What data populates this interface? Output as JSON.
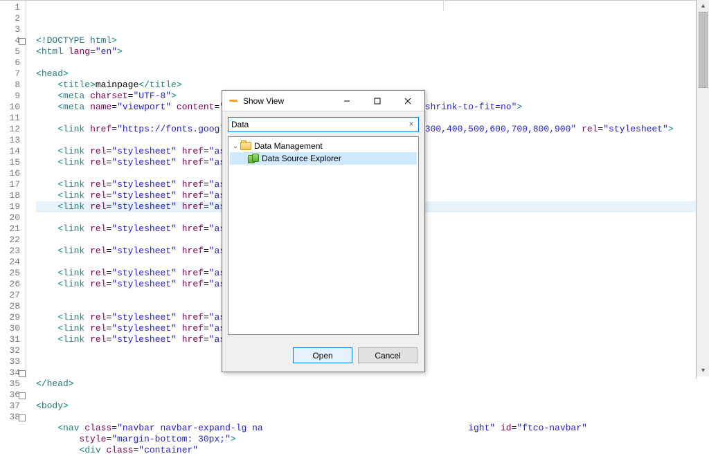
{
  "editor": {
    "lines": [
      {
        "n": "1",
        "fold": "",
        "html": "<span class='punc'>&lt;!</span><span class='tag'>DOCTYPE</span> <span class='kw'>html</span><span class='punc'>&gt;</span>"
      },
      {
        "n": "2",
        "fold": "",
        "html": "<span class='punc'>&lt;</span><span class='tag'>html</span> <span class='attr'>lang</span>=<span class='val'>\"en\"</span><span class='punc'>&gt;</span>"
      },
      {
        "n": "3",
        "fold": "",
        "html": ""
      },
      {
        "n": "4",
        "fold": "minus",
        "html": "<span class='punc'>&lt;</span><span class='tag'>head</span><span class='punc'>&gt;</span>"
      },
      {
        "n": "5",
        "fold": "",
        "html": "    <span class='punc'>&lt;</span><span class='tag'>title</span><span class='punc'>&gt;</span>mainpage<span class='punc'>&lt;/</span><span class='tag'>title</span><span class='punc'>&gt;</span>"
      },
      {
        "n": "6",
        "fold": "",
        "html": "    <span class='punc'>&lt;</span><span class='tag'>meta</span> <span class='attr'>charset</span>=<span class='val'>\"UTF-8\"</span><span class='punc'>&gt;</span>"
      },
      {
        "n": "7",
        "fold": "",
        "html": "    <span class='punc'>&lt;</span><span class='tag'>meta</span> <span class='attr'>name</span>=<span class='val'>\"viewport\"</span> <span class='attr'>content</span>=<span class='val'>\"width=device-width, initial-scale=1, shrink-to-fit=no\"</span><span class='punc'>&gt;</span>"
      },
      {
        "n": "8",
        "fold": "",
        "html": ""
      },
      {
        "n": "9",
        "fold": "",
        "html": "    <span class='punc'>&lt;</span><span class='tag'>link</span> <span class='attr'>href</span>=<span class='val'>\"https://fonts.googleapis.com/css?family=Poppins:100,200,300,400,500,600,700,800,900\"</span> <span class='attr'>rel</span>=<span class='val'>\"stylesheet\"</span><span class='punc'>&gt;</span>"
      },
      {
        "n": "10",
        "fold": "",
        "html": ""
      },
      {
        "n": "11",
        "fold": "",
        "html": "    <span class='punc'>&lt;</span><span class='tag'>link</span> <span class='attr'>rel</span>=<span class='val'>\"stylesheet\"</span> <span class='attr'>href</span>=<span class='val'>\"assets/cs</span>"
      },
      {
        "n": "12",
        "fold": "",
        "html": "    <span class='punc'>&lt;</span><span class='tag'>link</span> <span class='attr'>rel</span>=<span class='val'>\"stylesheet\"</span> <span class='attr'>href</span>=<span class='val'>\"assets/cs</span>"
      },
      {
        "n": "13",
        "fold": "",
        "html": ""
      },
      {
        "n": "14",
        "fold": "",
        "html": "    <span class='punc'>&lt;</span><span class='tag'>link</span> <span class='attr'>rel</span>=<span class='val'>\"stylesheet\"</span> <span class='attr'>href</span>=<span class='val'>\"assets/cs</span>"
      },
      {
        "n": "15",
        "fold": "",
        "html": "    <span class='punc'>&lt;</span><span class='tag'>link</span> <span class='attr'>rel</span>=<span class='val'>\"stylesheet\"</span> <span class='attr'>href</span>=<span class='val'>\"assets/cs</span>"
      },
      {
        "n": "16",
        "fold": "",
        "html": "    <span class='punc'>&lt;</span><span class='tag'>link</span> <span class='attr'>rel</span>=<span class='val'>\"stylesheet\"</span> <span class='attr'>href</span>=<span class='val'>\"assets/cs</span>",
        "hl": true
      },
      {
        "n": "17",
        "fold": "",
        "html": ""
      },
      {
        "n": "18",
        "fold": "",
        "html": "    <span class='punc'>&lt;</span><span class='tag'>link</span> <span class='attr'>rel</span>=<span class='val'>\"stylesheet\"</span> <span class='attr'>href</span>=<span class='val'>\"assets/cs</span>"
      },
      {
        "n": "19",
        "fold": "",
        "html": ""
      },
      {
        "n": "20",
        "fold": "",
        "html": "    <span class='punc'>&lt;</span><span class='tag'>link</span> <span class='attr'>rel</span>=<span class='val'>\"stylesheet\"</span> <span class='attr'>href</span>=<span class='val'>\"assets/cs</span>"
      },
      {
        "n": "21",
        "fold": "",
        "html": ""
      },
      {
        "n": "22",
        "fold": "",
        "html": "    <span class='punc'>&lt;</span><span class='tag'>link</span> <span class='attr'>rel</span>=<span class='val'>\"stylesheet\"</span> <span class='attr'>href</span>=<span class='val'>\"assets/cs</span>"
      },
      {
        "n": "23",
        "fold": "",
        "html": "    <span class='punc'>&lt;</span><span class='tag'>link</span> <span class='attr'>rel</span>=<span class='val'>\"stylesheet\"</span> <span class='attr'>href</span>=<span class='val'>\"assets/cs</span>"
      },
      {
        "n": "24",
        "fold": "",
        "html": ""
      },
      {
        "n": "25",
        "fold": "",
        "html": ""
      },
      {
        "n": "26",
        "fold": "",
        "html": "    <span class='punc'>&lt;</span><span class='tag'>link</span> <span class='attr'>rel</span>=<span class='val'>\"stylesheet\"</span> <span class='attr'>href</span>=<span class='val'>\"assets/cs</span>"
      },
      {
        "n": "27",
        "fold": "",
        "html": "    <span class='punc'>&lt;</span><span class='tag'>link</span> <span class='attr'>rel</span>=<span class='val'>\"stylesheet\"</span> <span class='attr'>href</span>=<span class='val'>\"assets/cs</span>"
      },
      {
        "n": "28",
        "fold": "",
        "html": "    <span class='punc'>&lt;</span><span class='tag'>link</span> <span class='attr'>rel</span>=<span class='val'>\"stylesheet\"</span> <span class='attr'>href</span>=<span class='val'>\"assets/cs</span>"
      },
      {
        "n": "29",
        "fold": "",
        "html": ""
      },
      {
        "n": "30",
        "fold": "",
        "html": ""
      },
      {
        "n": "31",
        "fold": "",
        "html": ""
      },
      {
        "n": "32",
        "fold": "",
        "html": "<span class='punc'>&lt;/</span><span class='tag'>head</span><span class='punc'>&gt;</span>"
      },
      {
        "n": "33",
        "fold": "",
        "html": ""
      },
      {
        "n": "34",
        "fold": "minus",
        "html": "<span class='punc'>&lt;</span><span class='tag'>body</span><span class='punc'>&gt;</span>"
      },
      {
        "n": "35",
        "fold": "",
        "html": ""
      },
      {
        "n": "36",
        "fold": "minus",
        "html": "    <span class='punc'>&lt;</span><span class='tag'>nav</span> <span class='attr'>class</span>=<span class='val'>\"navbar navbar-expand-lg na                                      ight\"</span> <span class='attr'>id</span>=<span class='val'>\"ftco-navbar\"</span>"
      },
      {
        "n": "37",
        "fold": "",
        "html": "        <span class='attr'>style</span>=<span class='val'>\"margin-bottom: 30px;\"</span><span class='punc'>&gt;</span>"
      },
      {
        "n": "38",
        "fold": "minus",
        "html": "        <span class='punc'>&lt;</span><span class='tag'>div</span> <span class='attr'>class</span>=<span class='val'>\"container\"</span>"
      }
    ]
  },
  "dialog": {
    "title": "Show View",
    "search_value": "Data",
    "clear_glyph": "×",
    "tree": {
      "parent": "Data Management",
      "child": "Data Source Explorer"
    },
    "buttons": {
      "open": "Open",
      "cancel": "Cancel"
    },
    "winbtn": {
      "min": "—",
      "max": "☐",
      "close": "✕"
    }
  }
}
